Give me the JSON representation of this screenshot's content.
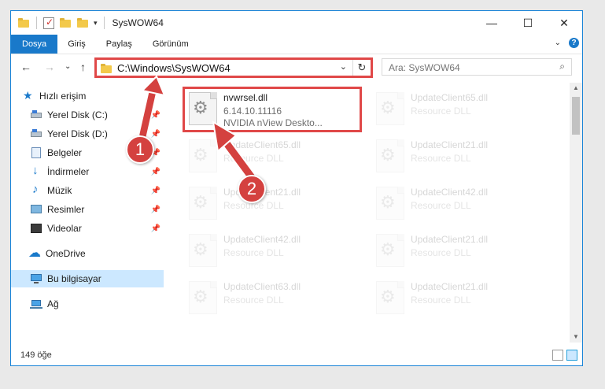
{
  "window": {
    "title": "SysWOW64",
    "controls": {
      "minimize": "—",
      "maximize": "☐",
      "close": "✕"
    }
  },
  "quick_access_toolbar": {
    "more": "▾"
  },
  "ribbon": {
    "tabs": [
      {
        "label": "Dosya"
      },
      {
        "label": "Giriş"
      },
      {
        "label": "Paylaş"
      },
      {
        "label": "Görünüm"
      }
    ],
    "expand": "⌄",
    "help": "?"
  },
  "navigation": {
    "back": "←",
    "forward": "→",
    "recent": "⌄",
    "up": "↑"
  },
  "address": {
    "path": "C:\\Windows\\SysWOW64",
    "dropdown": "⌄",
    "refresh": "↻"
  },
  "search": {
    "placeholder": "Ara: SysWOW64",
    "icon": "⌕"
  },
  "nav_pane": {
    "pin_glyph": "📌",
    "items": [
      {
        "label": "Hızlı erişim",
        "icon": "star-icon"
      },
      {
        "label": "Yerel Disk (C:)",
        "icon": "disk-icon",
        "pinned": true
      },
      {
        "label": "Yerel Disk (D:)",
        "icon": "disk-icon",
        "pinned": true
      },
      {
        "label": "Belgeler",
        "icon": "documents-icon",
        "pinned": true
      },
      {
        "label": "İndirmeler",
        "icon": "downloads-icon",
        "pinned": true
      },
      {
        "label": "Müzik",
        "icon": "music-icon",
        "pinned": true
      },
      {
        "label": "Resimler",
        "icon": "pictures-icon",
        "pinned": true
      },
      {
        "label": "Videolar",
        "icon": "videos-icon",
        "pinned": true
      },
      {
        "label": "OneDrive",
        "icon": "onedrive-icon"
      },
      {
        "label": "Bu bilgisayar",
        "icon": "this-pc-icon",
        "selected": true
      },
      {
        "label": "Ağ",
        "icon": "network-icon"
      }
    ]
  },
  "files": [
    {
      "name": "nvwrsel.dll",
      "line1": "6.14.10.11116",
      "line2": "NVIDIA nView Deskto...",
      "highlighted": true
    },
    {
      "name": "UpdateClient65.dll",
      "line1": "Resource DLL"
    },
    {
      "name": "UpdateClient65.dll",
      "line1": "Resource DLL"
    },
    {
      "name": "UpdateClient21.dll",
      "line1": "Resource DLL"
    },
    {
      "name": "UpdateClient21.dll",
      "line1": "Resource DLL"
    },
    {
      "name": "UpdateClient42.dll",
      "line1": "Resource DLL"
    },
    {
      "name": "UpdateClient42.dll",
      "line1": "Resource DLL"
    },
    {
      "name": "UpdateClient21.dll",
      "line1": "Resource DLL"
    },
    {
      "name": "UpdateClient63.dll",
      "line1": "Resource DLL"
    },
    {
      "name": "UpdateClient21.dll",
      "line1": "Resource DLL"
    }
  ],
  "scrollbar": {
    "up": "▲",
    "down": "▼"
  },
  "status": {
    "count": "149 öğe"
  },
  "annotations": {
    "marker1": "1",
    "marker2": "2",
    "color": "#d4413f"
  }
}
